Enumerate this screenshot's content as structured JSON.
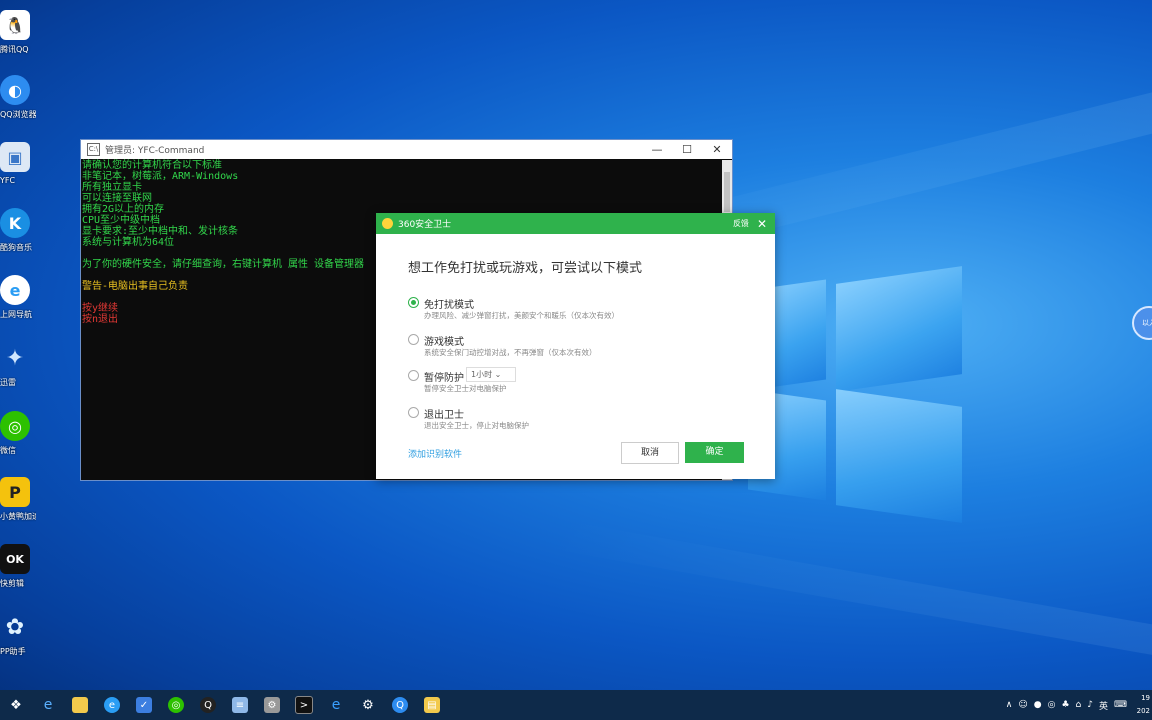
{
  "desktop": {
    "icons": [
      {
        "label": "腾讯QQ",
        "icon": "qq-penguin-icon",
        "color": "#1a1a1a"
      },
      {
        "label": "QQ浏览器",
        "icon": "qq-browser-icon",
        "color": "#2d8cf0"
      },
      {
        "label": "YFC",
        "icon": "computer-icon",
        "color": "#3c78c8"
      },
      {
        "label": "酷狗音乐",
        "icon": "kugou-icon",
        "color": "#1a8fe3"
      },
      {
        "label": "上网导航",
        "icon": "edge-e-icon",
        "color": "#2a9df4"
      },
      {
        "label": "迅雷",
        "icon": "thunder-bird-icon",
        "color": "#1e6fd9"
      },
      {
        "label": "微信",
        "icon": "wechat-icon",
        "color": "#2dc100"
      },
      {
        "label": "小黄鸭加速器",
        "icon": "p-coin-icon",
        "color": "#f4c20d"
      },
      {
        "label": "快剪辑",
        "icon": "ok-clip-icon",
        "color": "#111111"
      },
      {
        "label": "PP助手",
        "icon": "flower-icon",
        "color": "#5fb8ff"
      }
    ]
  },
  "cmd": {
    "title": "管理员:  YFC-Command",
    "lines": [
      {
        "text": "请确认您的计算机符合以下标准",
        "color": "#32d74b"
      },
      {
        "text": "非笔记本，树莓派，ARM-Windows",
        "color": "#32d74b"
      },
      {
        "text": "所有独立显卡",
        "color": "#32d74b"
      },
      {
        "text": "可以连接至联网",
        "color": "#32d74b"
      },
      {
        "text": "拥有2G以上的内存",
        "color": "#32d74b"
      },
      {
        "text": "CPU至少中级中档",
        "color": "#32d74b"
      },
      {
        "text": "显卡要求:至少中档中和、发计核条",
        "color": "#32d74b"
      },
      {
        "text": "系统与计算机为64位",
        "color": "#32d74b"
      },
      {
        "text": "",
        "color": "#32d74b"
      },
      {
        "text": "为了你的硬件安全，请仔细查询，右键计算机 属性 设备管理器",
        "color": "#32d74b"
      },
      {
        "text": "",
        "color": "#32d74b"
      },
      {
        "text": "警告-电脑出事自己负责",
        "color": "#e8c020"
      },
      {
        "text": "",
        "color": "#32d74b"
      },
      {
        "text": "按y继续",
        "color": "#e53935"
      },
      {
        "text": "按n退出",
        "color": "#e53935"
      }
    ]
  },
  "dialog": {
    "title": "360安全卫士",
    "feedback": "反馈",
    "heading": "想工作免打扰或玩游戏，可尝试以下模式",
    "options": [
      {
        "name": "免打扰模式",
        "desc": "办理风险、减少弹窗打扰，美颜安个和暖乐（仅本次有效）",
        "checked": true
      },
      {
        "name": "游戏模式",
        "desc": "系统安全保门动控增对战，不再弹窗（仅本次有效）",
        "checked": false
      },
      {
        "name": "暂停防护",
        "desc": "暂停安全卫士对电脑保护",
        "checked": false,
        "select": "1小时"
      },
      {
        "name": "退出卫士",
        "desc": "退出安全卫士，停止对电脑保护",
        "checked": false
      }
    ],
    "link": "添加识别软件",
    "cancel": "取消",
    "ok": "确定"
  },
  "edge_bubble": "以入",
  "taskbar": {
    "icons": [
      "windows-start-icon",
      "ie-icon",
      "file-explorer-icon",
      "edge-icon",
      "thunder-icon",
      "wechat-icon",
      "qq-icon",
      "notepad-icon",
      "settings-tool-icon",
      "cmd-icon",
      "edge-blue-icon",
      "gear-icon",
      "qq-browser-icon",
      "folder-icon"
    ],
    "clock_time": "19",
    "clock_date": "202"
  }
}
